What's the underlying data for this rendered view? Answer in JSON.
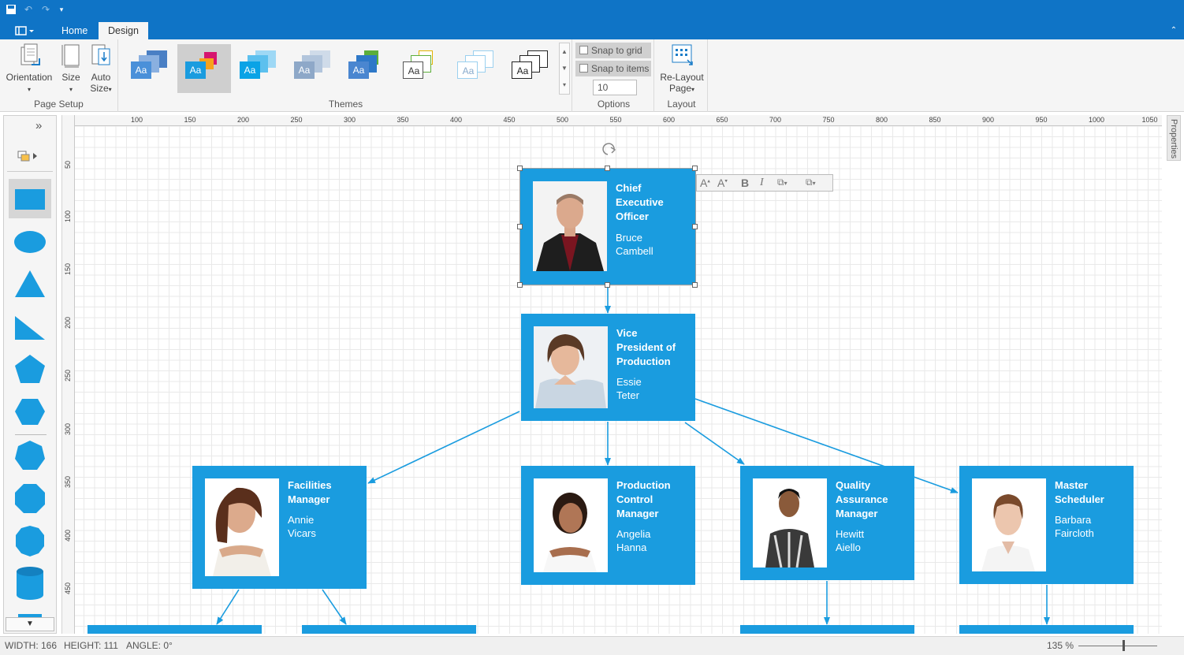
{
  "ribbon": {
    "tabs": [
      {
        "label": "Home"
      },
      {
        "label": "Design"
      }
    ],
    "groups": {
      "page_setup": {
        "label": "Page Setup",
        "orientation": "Orientation",
        "size": "Size",
        "auto_size_line1": "Auto",
        "auto_size_line2": "Size"
      },
      "themes": {
        "label": "Themes",
        "sample": "Aa"
      },
      "options": {
        "label": "Options",
        "snap_to_grid": "Snap to grid",
        "snap_to_items": "Snap to items",
        "grid_value": "10"
      },
      "layout": {
        "label": "Layout",
        "relayout_line1": "Re-Layout",
        "relayout_line2": "Page"
      }
    }
  },
  "ruler": {
    "h_ticks": [
      "100",
      "150",
      "200",
      "250",
      "300",
      "350",
      "400",
      "450",
      "500",
      "550",
      "600",
      "650",
      "700",
      "750",
      "800",
      "850",
      "900",
      "950",
      "1000",
      "1050"
    ],
    "v_ticks": [
      "50",
      "100",
      "150",
      "200",
      "250",
      "300",
      "350",
      "400",
      "450"
    ]
  },
  "side_panel": {
    "properties_label": "Properties"
  },
  "org": {
    "ceo": {
      "title_lines": [
        "Chief",
        "Executive",
        "Officer"
      ],
      "name_lines": [
        "Bruce",
        "Cambell"
      ]
    },
    "vp": {
      "title_lines": [
        "Vice",
        "President of",
        "Production"
      ],
      "name_lines": [
        "Essie",
        "Teter"
      ]
    },
    "facilities": {
      "title_lines": [
        "Facilities",
        "Manager"
      ],
      "name_lines": [
        "Annie",
        "Vicars"
      ]
    },
    "production": {
      "title_lines": [
        "Production",
        "Control",
        "Manager"
      ],
      "name_lines": [
        "Angelia",
        "Hanna"
      ]
    },
    "quality": {
      "title_lines": [
        "Quality",
        "Assurance",
        "Manager"
      ],
      "name_lines": [
        "Hewitt",
        "Aiello"
      ]
    },
    "scheduler": {
      "title_lines": [
        "Master",
        "Scheduler"
      ],
      "name_lines": [
        "Barbara",
        "Faircloth"
      ]
    }
  },
  "status": {
    "width": "WIDTH: 166",
    "height": "HEIGHT: 111",
    "angle": "ANGLE: 0°",
    "zoom": "135 %"
  },
  "colors": {
    "accent": "#0f74c6",
    "node": "#1a9cdf"
  }
}
